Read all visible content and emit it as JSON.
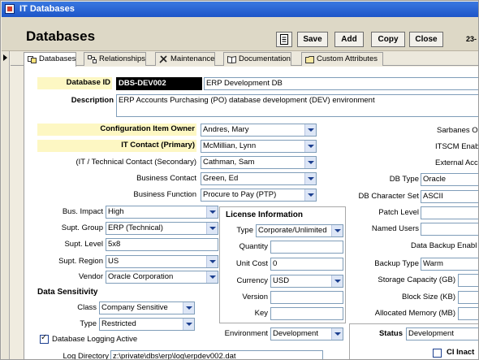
{
  "window": {
    "title": "IT Databases"
  },
  "header": {
    "form_title": "Databases",
    "buttons": {
      "save": "Save",
      "add": "Add",
      "copy": "Copy",
      "close": "Close"
    },
    "record_counter": "23-"
  },
  "tabs": [
    {
      "label": "Databases",
      "icon": "database-icon",
      "active": true
    },
    {
      "label": "Relationships",
      "icon": "relationships-icon"
    },
    {
      "label": "Maintenance",
      "icon": "tools-icon"
    },
    {
      "label": "Documentation",
      "icon": "book-icon"
    },
    {
      "label": "Custom Attributes",
      "icon": "folder-icon"
    }
  ],
  "form": {
    "database_id": {
      "label": "Database ID",
      "value": "DBS-DEV002",
      "name": "ERP Development DB"
    },
    "description": {
      "label": "Description",
      "value": "ERP Accounts Purchasing (PO) database development (DEV) environment"
    },
    "ci_owner": {
      "label": "Configuration Item Owner",
      "value": "Andres, Mary"
    },
    "it_contact_primary": {
      "label": "IT Contact (Primary)",
      "value": "McMillian, Lynn"
    },
    "it_contact_secondary": {
      "label": "(IT / Technical Contact (Secondary)",
      "value": "Cathman, Sam"
    },
    "business_contact": {
      "label": "Business Contact",
      "value": "Green, Ed"
    },
    "business_function": {
      "label": "Business Function",
      "value": "Procure to Pay (PTP)"
    },
    "bus_impact": {
      "label": "Bus. Impact",
      "value": "High"
    },
    "supt_group": {
      "label": "Supt. Group",
      "value": "ERP (Technical)"
    },
    "supt_level": {
      "label": "Supt. Level",
      "value": "5x8"
    },
    "supt_region": {
      "label": "Supt. Region",
      "value": "US"
    },
    "vendor": {
      "label": "Vendor",
      "value": "Oracle Corporation"
    },
    "data_sensitivity": {
      "title": "Data Sensitivity",
      "class_label": "Class",
      "class_value": "Company Sensitive",
      "type_label": "Type",
      "type_value": "Restricted"
    },
    "db_logging": {
      "label": "Database Logging Active",
      "checked": true
    },
    "log_directory": {
      "label": "Log Directory",
      "value": "z:\\private\\dbs\\erp\\log\\erpdev002.dat"
    },
    "license": {
      "title": "License Information",
      "type_label": "Type",
      "type_value": "Corporate/Unlimited",
      "quantity_label": "Quantity",
      "quantity_value": "",
      "unit_cost_label": "Unit Cost",
      "unit_cost_value": "0",
      "currency_label": "Currency",
      "currency_value": "USD",
      "version_label": "Version",
      "version_value": "",
      "key_label": "Key",
      "key_value": ""
    },
    "environment": {
      "label": "Environment",
      "value": "Development"
    },
    "right": {
      "sarbanes_label": "Sarbanes Ox",
      "itscm_label": "ITSCM Enab",
      "external_label": "External Acc",
      "db_type_label": "DB Type",
      "db_type_value": "Oracle",
      "db_charset_label": "DB Character Set",
      "db_charset_value": "ASCII",
      "patch_level_label": "Patch Level",
      "patch_level_value": "",
      "named_users_label": "Named Users",
      "named_users_value": "",
      "data_backup_label": "Data Backup Enabl",
      "backup_type_label": "Backup Type",
      "backup_type_value": "Warm",
      "storage_label": "Storage Capacity (GB)",
      "storage_value": "",
      "block_size_label": "Block Size (KB)",
      "block_size_value": "",
      "alloc_mem_label": "Allocated Memory (MB)",
      "alloc_mem_value": "",
      "status_label": "Status",
      "status_value": "Development",
      "ci_inactive_label": "CI Inact"
    }
  }
}
